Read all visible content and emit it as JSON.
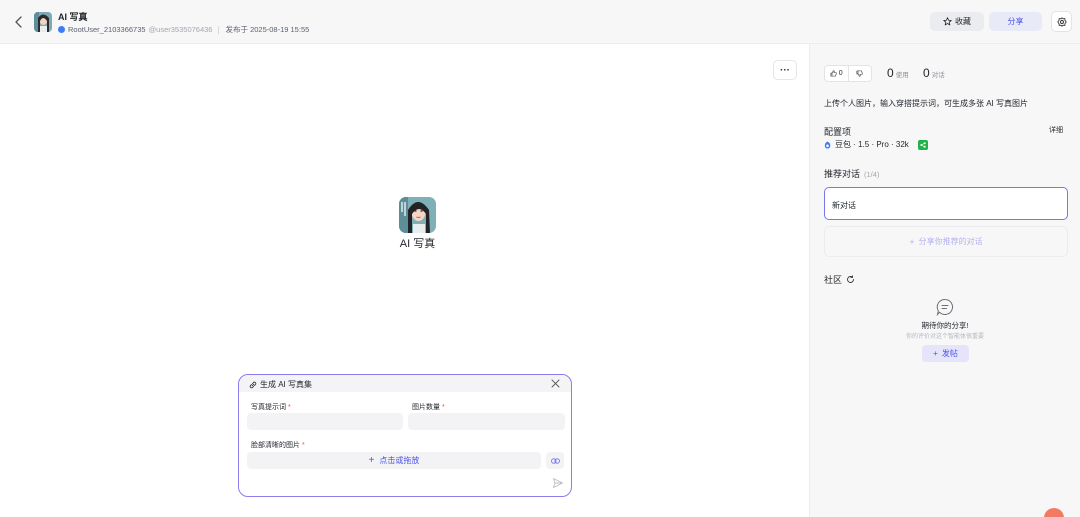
{
  "header": {
    "app_title": "AI 写真",
    "author": "RootUser_2103366735",
    "handle": "@user3535076436",
    "published": "发布于 2025-08-19 15:55",
    "favorite_label": "收藏",
    "share_label": "分享"
  },
  "main": {
    "more_label": "···",
    "bot_name": "AI 写真"
  },
  "form": {
    "title": "生成 AI 写真集",
    "prompt_label": "写真提示词",
    "count_label": "图片数量",
    "face_label": "脸部清晰的图片",
    "required_mark": "*",
    "prompt_value": "",
    "count_value": "",
    "upload_label": "点击或拖放",
    "upload_plus": "+"
  },
  "sidebar": {
    "like_count": "0",
    "use_count": "0",
    "use_unit": "使用",
    "chat_count": "0",
    "chat_unit": "对话",
    "description": "上传个人图片，输入穿搭提示词，可生成多张 AI 写真图片",
    "config_title": "配置项",
    "detail_link": "详细",
    "model_info": "豆包 · 1.5 · Pro · 32k",
    "recommend_title": "推荐对话",
    "recommend_progress": "(1/4)",
    "convo_item": "新对话",
    "share_convo_label": "分享你推荐的对话",
    "community_title": "社区",
    "empty_title": "期待你的分享!",
    "empty_sub": "你的评价对这个智能体很重要",
    "post_label": "发帖",
    "plus": "+"
  },
  "colors": {
    "accent": "#4d53e8",
    "card_border": "#8a7df0",
    "required": "#f54a45",
    "green": "#21b34a"
  }
}
